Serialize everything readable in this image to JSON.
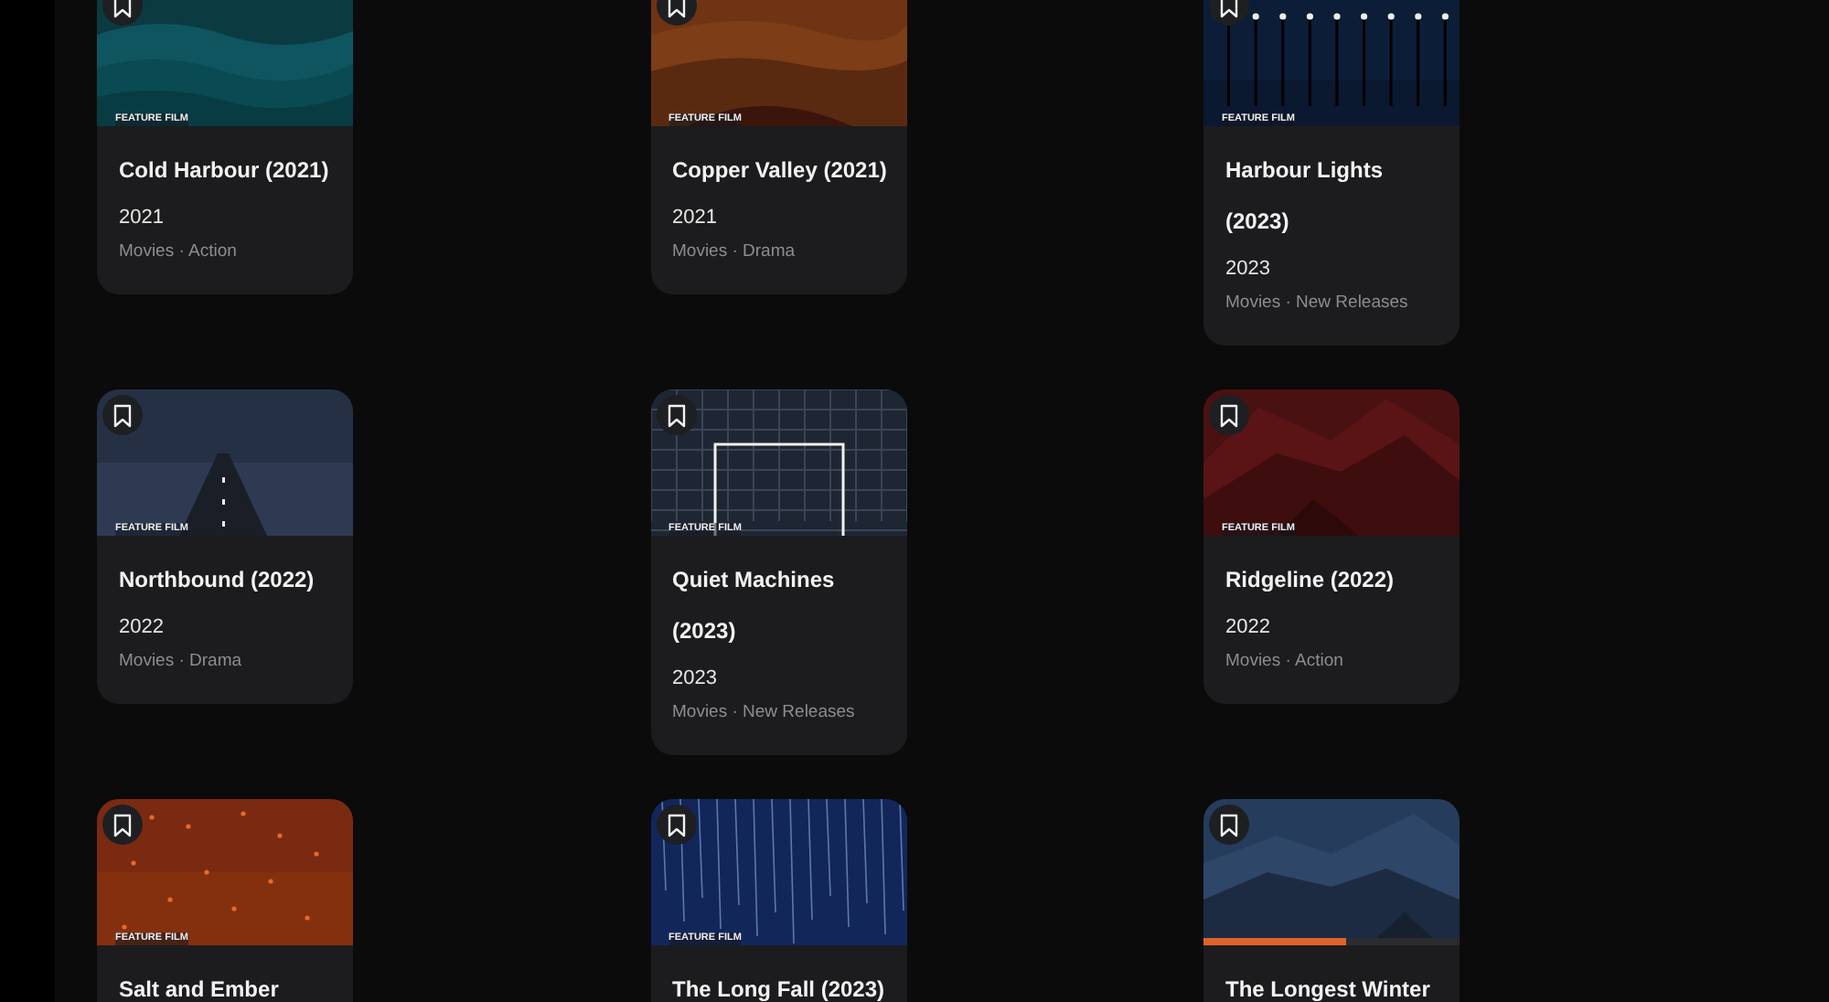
{
  "cards": [
    {
      "label": "FEATURE FILM",
      "title": "Cold Harbour (2021)",
      "year": "2021",
      "meta": "Movies · Action"
    },
    {
      "label": "FEATURE FILM",
      "title": "Copper Valley (2021)",
      "year": "2021",
      "meta": "Movies · Drama"
    },
    {
      "label": "FEATURE FILM",
      "title": "Harbour Lights (2023)",
      "year": "2023",
      "meta": "Movies · New Releases"
    },
    {
      "label": "FEATURE FILM",
      "title": "Northbound (2022)",
      "year": "2022",
      "meta": "Movies · Drama"
    },
    {
      "label": "FEATURE FILM",
      "title": "Quiet Machines (2023)",
      "year": "2023",
      "meta": "Movies · New Releases"
    },
    {
      "label": "FEATURE FILM",
      "title": "Ridgeline (2022)",
      "year": "2022",
      "meta": "Movies · Action"
    },
    {
      "label": "FEATURE FILM",
      "title": "Salt and Ember"
    },
    {
      "label": "FEATURE FILM",
      "title": "The Long Fall (2023)"
    },
    {
      "title": "The Longest Winter",
      "progress": {
        "level": 0.56
      }
    }
  ]
}
